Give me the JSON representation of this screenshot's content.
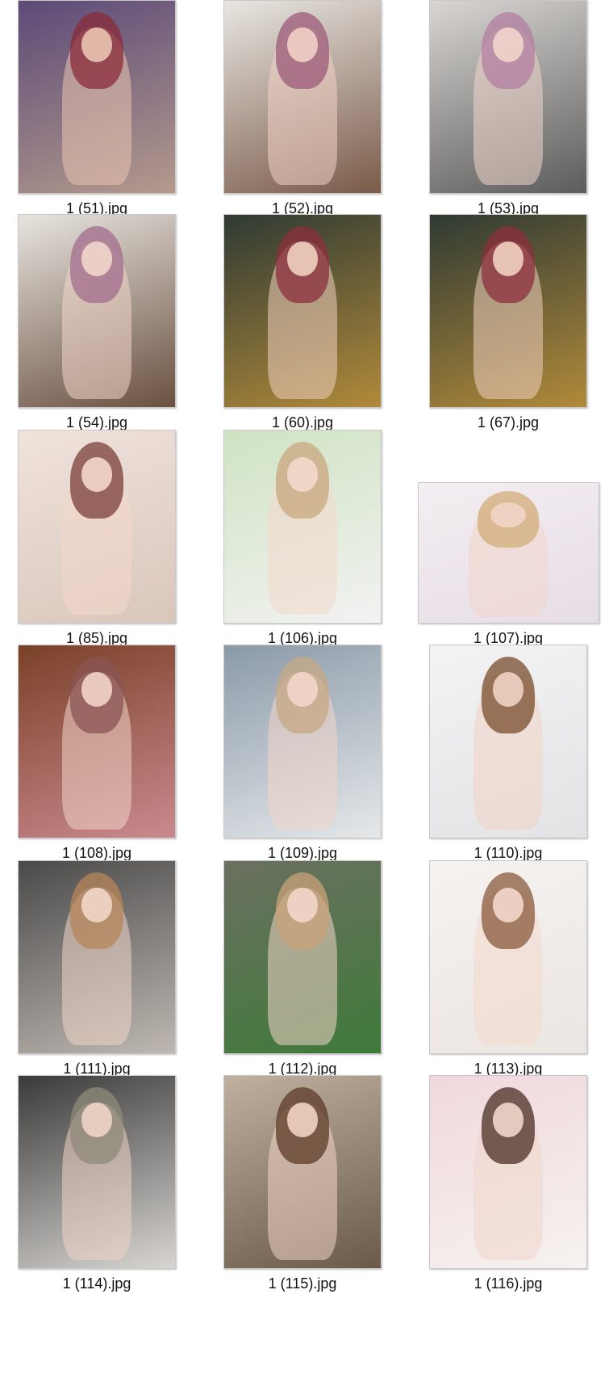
{
  "files": [
    {
      "name": "1 (51).jpg",
      "shape": "portrait",
      "bg": [
        "#5b4a78",
        "#b49a8c"
      ],
      "hair": "#8a2b3a",
      "skin": "#e9c4b0"
    },
    {
      "name": "1 (52).jpg",
      "shape": "portrait",
      "bg": [
        "#e8e6e2",
        "#7a5a48"
      ],
      "hair": "#9b5a7a",
      "skin": "#f1d2c4"
    },
    {
      "name": "1 (53).jpg",
      "shape": "portrait",
      "bg": [
        "#d9d6d2",
        "#5c5c5c"
      ],
      "hair": "#b27da0",
      "skin": "#f1d6cb"
    },
    {
      "name": "1 (54).jpg",
      "shape": "portrait",
      "bg": [
        "#e7e4df",
        "#6a5040"
      ],
      "hair": "#a26c8c",
      "skin": "#f2d7cb"
    },
    {
      "name": "1 (60).jpg",
      "shape": "portrait",
      "bg": [
        "#2f3a33",
        "#b18a3a"
      ],
      "hair": "#8c2f3c",
      "skin": "#efd0bf"
    },
    {
      "name": "1 (67).jpg",
      "shape": "portrait",
      "bg": [
        "#2f3a33",
        "#b18a3a"
      ],
      "hair": "#8c2f3c",
      "skin": "#efd0bf"
    },
    {
      "name": "1 (85).jpg",
      "shape": "portrait",
      "bg": [
        "#efe3dc",
        "#d9c6bb"
      ],
      "hair": "#7a3d3a",
      "skin": "#f4d8ca"
    },
    {
      "name": "1 (106).jpg",
      "shape": "portrait",
      "bg": [
        "#cfe3c2",
        "#f2f2f2"
      ],
      "hair": "#c8a77f",
      "skin": "#f3d9cc"
    },
    {
      "name": "1 (107).jpg",
      "shape": "landscape",
      "bg": [
        "#f3eef2",
        "#e7dde5"
      ],
      "hair": "#d2ac78",
      "skin": "#f2d5c8"
    },
    {
      "name": "1 (108).jpg",
      "shape": "portrait",
      "bg": [
        "#7a4128",
        "#c98a8f"
      ],
      "hair": "#8a5454",
      "skin": "#f2d4c6"
    },
    {
      "name": "1 (109).jpg",
      "shape": "portrait",
      "bg": [
        "#8b9aa8",
        "#e5e8ea"
      ],
      "hair": "#c6a884",
      "skin": "#f2d6ca"
    },
    {
      "name": "1 (110).jpg",
      "shape": "portrait",
      "bg": [
        "#f3f3f3",
        "#e3e3e6"
      ],
      "hair": "#7a4b2e",
      "skin": "#f0d3c5"
    },
    {
      "name": "1 (111).jpg",
      "shape": "portrait",
      "bg": [
        "#4a4a4a",
        "#bfb8b2"
      ],
      "hair": "#b7865a",
      "skin": "#f1d6c9"
    },
    {
      "name": "1 (112).jpg",
      "shape": "portrait",
      "bg": [
        "#6b7060",
        "#3f7a3a"
      ],
      "hair": "#caa37a",
      "skin": "#f2d6c9"
    },
    {
      "name": "1 (113).jpg",
      "shape": "portrait",
      "bg": [
        "#f5f2f0",
        "#ece6e3"
      ],
      "hair": "#8a5a3c",
      "skin": "#f3d8cc"
    },
    {
      "name": "1 (114).jpg",
      "shape": "portrait",
      "bg": [
        "#3a3a3a",
        "#d9d6d2"
      ],
      "hair": "#8f8a7a",
      "skin": "#f0d4c7"
    },
    {
      "name": "1 (115).jpg",
      "shape": "portrait",
      "bg": [
        "#bfb0a0",
        "#6b5a4a"
      ],
      "hair": "#5c3b27",
      "skin": "#f1d3c4"
    },
    {
      "name": "1 (116).jpg",
      "shape": "portrait",
      "bg": [
        "#f0d8dc",
        "#f6f2f0"
      ],
      "hair": "#4a2e24",
      "skin": "#f1d6ca"
    }
  ]
}
